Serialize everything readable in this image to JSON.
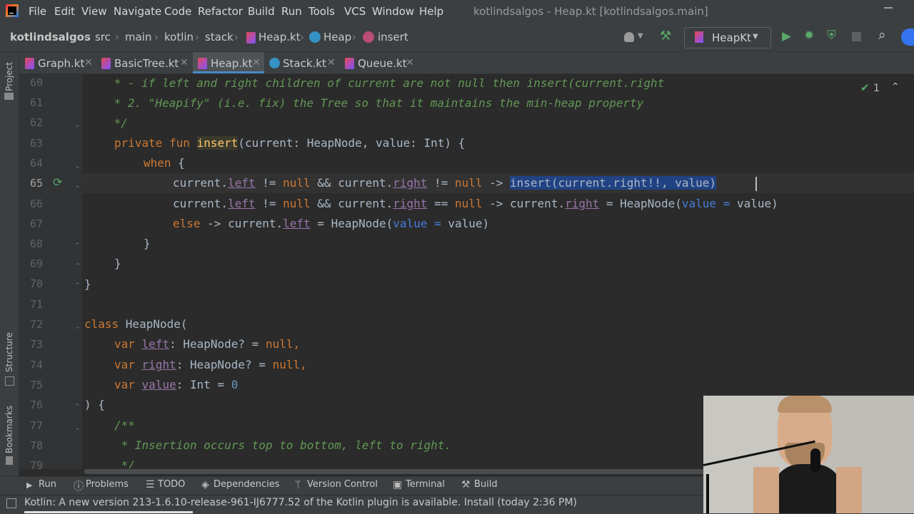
{
  "menu": [
    "File",
    "Edit",
    "View",
    "Navigate",
    "Code",
    "Refactor",
    "Build",
    "Run",
    "Tools",
    "VCS",
    "Window",
    "Help"
  ],
  "window_title": "kotlindsalgos - Heap.kt [kotlindsalgos.main]",
  "breadcrumb": [
    "kotlindsalgos",
    "src",
    "main",
    "kotlin",
    "stack",
    "Heap.kt",
    "Heap",
    "insert"
  ],
  "run_config": "HeapKt",
  "tabs": [
    {
      "label": "Graph.kt",
      "active": false
    },
    {
      "label": "BasicTree.kt",
      "active": false
    },
    {
      "label": "Heap.kt",
      "active": true
    },
    {
      "label": "Stack.kt",
      "active": false
    },
    {
      "label": "Queue.kt",
      "active": false
    }
  ],
  "sidebar": {
    "project": "Project",
    "structure": "Structure",
    "bookmarks": "Bookmarks"
  },
  "inspection_count": "1",
  "line_numbers": [
    "60",
    "61",
    "62",
    "63",
    "64",
    "65",
    "66",
    "67",
    "68",
    "69",
    "70",
    "71",
    "72",
    "73",
    "74",
    "75",
    "76",
    "77",
    "78",
    "79"
  ],
  "code": {
    "l60": " * - if left and right children of current are not null then insert(current.right",
    "l61": " * 2. \"Heapify\" (i.e. fix) the Tree so that it maintains the min-heap property",
    "l62": " */",
    "l63_kw": "private fun ",
    "l63_fn": "insert",
    "l63_rest": "(current: HeapNode, value: Int) {",
    "l64_kw": "when",
    "l64_rest": " {",
    "null": "null",
    "else": "else",
    "left": "left",
    "right": "right",
    "value": "value",
    "l65_sel": "insert(current.right!!, value)",
    "l67_ctor": "HeapNode(",
    "l70": "}",
    "l72_kw": "class ",
    "l72_rest": "HeapNode(",
    "var": "var",
    "zero": "0",
    "l73_type": ": HeapNode? = ",
    "l75_type": ": Int = ",
    "l76": ") {",
    "l77": "/**",
    "l78": " * Insertion occurs top to bottom, left to right.",
    "l79": " */"
  },
  "tool_windows": [
    "Run",
    "Problems",
    "TODO",
    "Dependencies",
    "Version Control",
    "Terminal",
    "Build"
  ],
  "status_message": "Kotlin: A new version 213-1.6.10-release-961-IJ6777.52 of the Kotlin plugin is available. Install (today 2:36 PM)",
  "colors": {
    "keyword": "#cc7832",
    "function": "#ffc66d",
    "comment": "#629755",
    "property": "#9876aa",
    "number": "#6897bb",
    "selection": "#214283",
    "accent": "#4a88c7"
  }
}
